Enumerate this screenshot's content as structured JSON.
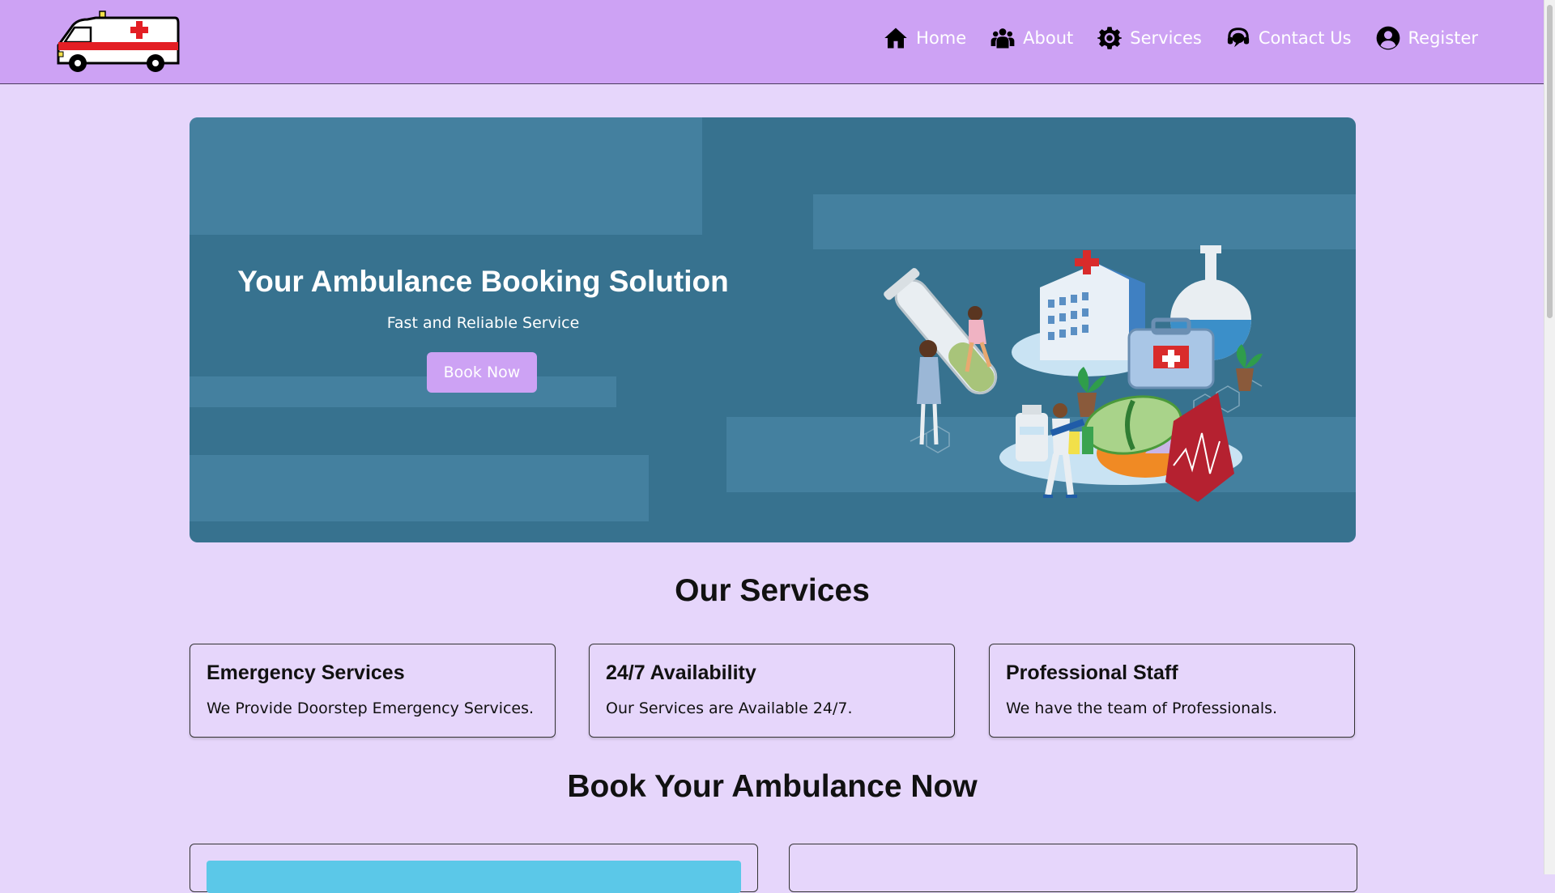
{
  "nav": {
    "items": [
      {
        "label": "Home",
        "icon": "home-icon"
      },
      {
        "label": "About",
        "icon": "users-icon"
      },
      {
        "label": "Services",
        "icon": "gear-icon"
      },
      {
        "label": "Contact Us",
        "icon": "headset-icon"
      },
      {
        "label": "Register",
        "icon": "user-circle-icon"
      }
    ]
  },
  "hero": {
    "title": "Your Ambulance Booking Solution",
    "subtitle": "Fast and Reliable Service",
    "button": "Book Now"
  },
  "services": {
    "title": "Our Services",
    "cards": [
      {
        "title": "Emergency Services",
        "text": "We Provide Doorstep Emergency Services."
      },
      {
        "title": "24/7 Availability",
        "text": "Our Services are Available 24/7."
      },
      {
        "title": "Professional Staff",
        "text": "We have the team of Professionals."
      }
    ]
  },
  "booking": {
    "title": "Book Your Ambulance Now"
  },
  "colors": {
    "header": "#cda2f4",
    "background": "#e6d6fb",
    "hero": "#37728f",
    "button": "#cda2f4",
    "accent_strip": "#5bc8e8"
  }
}
